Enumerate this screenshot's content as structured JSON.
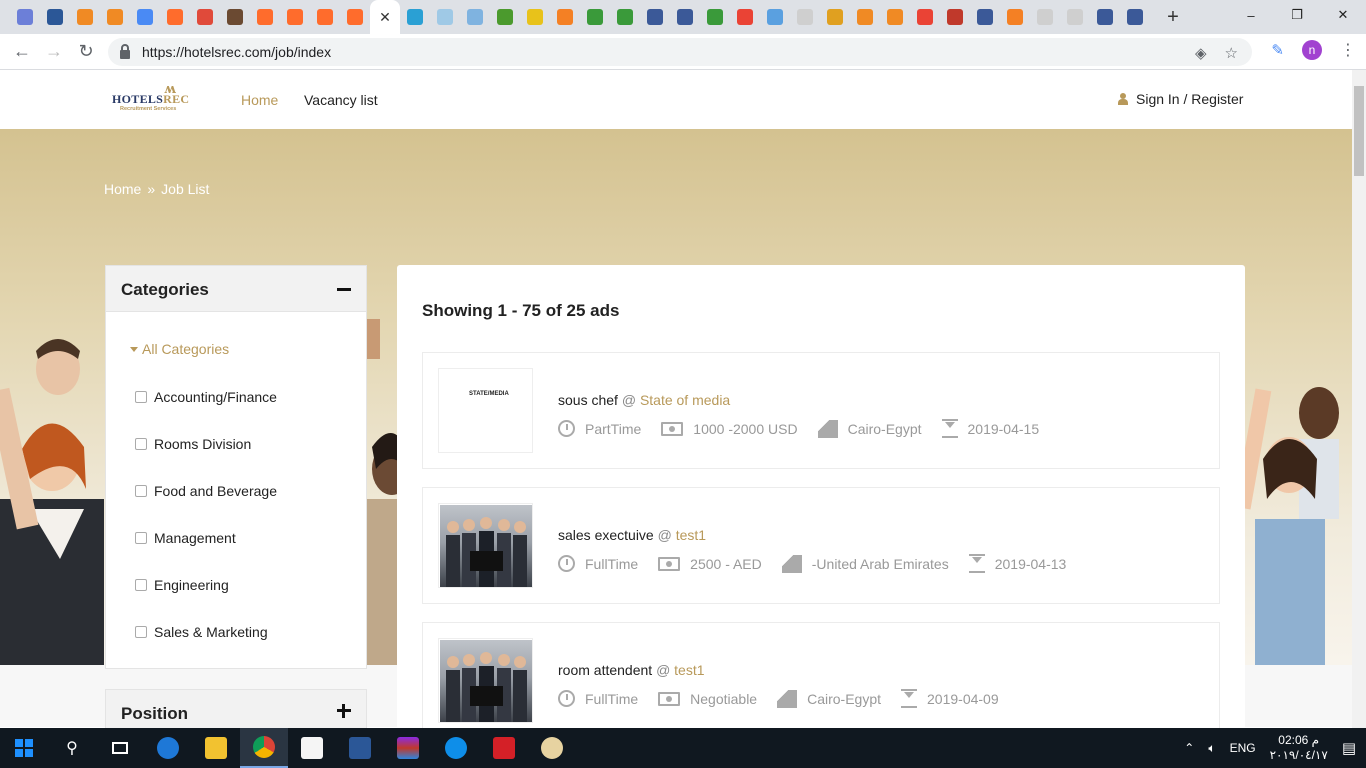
{
  "browser": {
    "close_tab_glyph": "✕",
    "new_tab_glyph": "+",
    "url": "https://hotelsrec.com/job/index",
    "window_controls": [
      "–",
      "❐",
      "✕"
    ],
    "profile_initial": "n"
  },
  "site": {
    "logo_name_a": "HOTELS",
    "logo_name_b": "REC",
    "logo_tagline": "Recruitment Services",
    "nav": {
      "home": "Home",
      "vacancy": "Vacancy list"
    },
    "signin": "Sign In / Register"
  },
  "breadcrumb": {
    "home": "Home",
    "sep": "»",
    "current": "Job List"
  },
  "categories": {
    "title": "Categories",
    "all": "All Categories",
    "items": [
      "Accounting/Finance",
      "Rooms Division",
      "Food and Beverage",
      "Management",
      "Engineering",
      "Sales & Marketing"
    ]
  },
  "position": {
    "title": "Position"
  },
  "results": {
    "summary": "Showing 1 - 75 of 25 ads",
    "jobs": [
      {
        "title": "sous chef",
        "at": "@",
        "company": "State of media",
        "type": "PartTime",
        "salary": "1000 -2000 USD",
        "location": "Cairo-Egypt",
        "date": "2019-04-15",
        "thumb_text": "STATE/MEDIA"
      },
      {
        "title": "sales exectuive",
        "at": "@",
        "company": "test1",
        "type": "FullTime",
        "salary": "2500 - AED",
        "location": "-United Arab Emirates",
        "date": "2019-04-13"
      },
      {
        "title": "room attendent",
        "at": "@",
        "company": "test1",
        "type": "FullTime",
        "salary": "Negotiable",
        "location": "Cairo-Egypt",
        "date": "2019-04-09"
      }
    ]
  },
  "taskbar": {
    "lang": "ENG",
    "time": "02:06 م",
    "date": "٢٠١٩/٠٤/١٧"
  },
  "colors": {
    "accent": "#b8995a",
    "navy": "#2a3a66"
  }
}
